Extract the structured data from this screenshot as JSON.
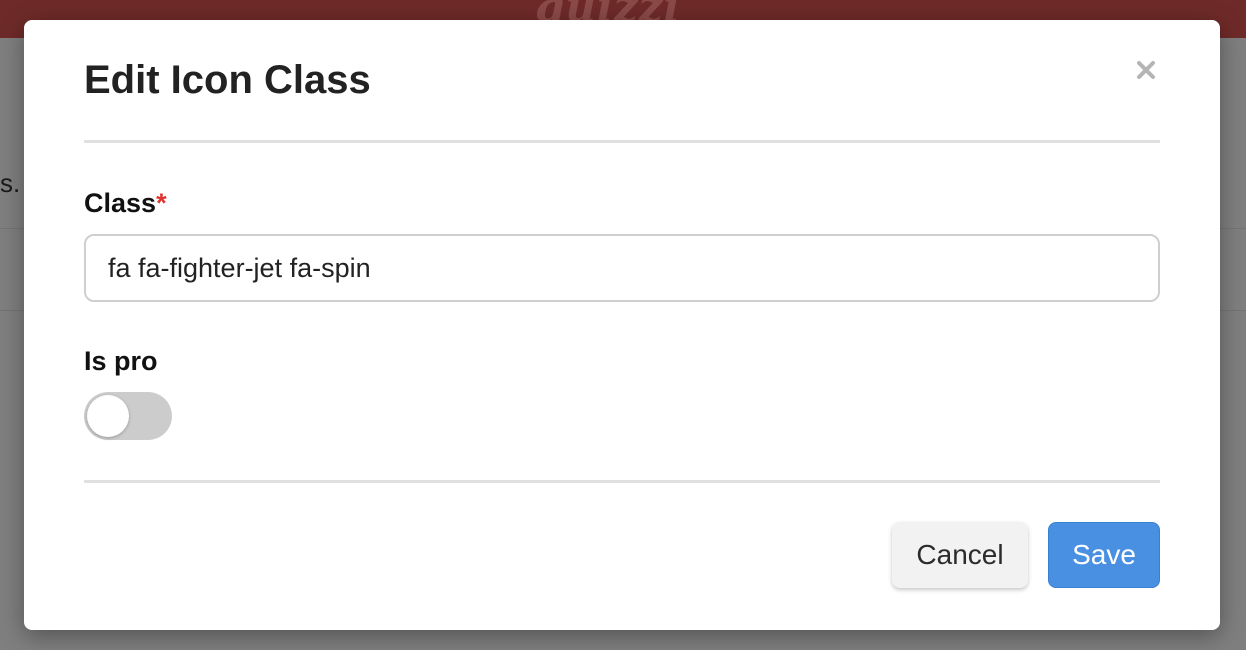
{
  "background": {
    "header_color": "#6e2a28",
    "logo_text": "quizzi",
    "text_fragment": "s."
  },
  "modal": {
    "title": "Edit Icon Class",
    "close_icon": "close-icon"
  },
  "form": {
    "class_field": {
      "label": "Class",
      "required_mark": "*",
      "value": "fa fa-fighter-jet fa-spin",
      "placeholder": ""
    },
    "is_pro_field": {
      "label": "Is pro",
      "checked": false
    }
  },
  "footer": {
    "cancel_label": "Cancel",
    "save_label": "Save"
  },
  "colors": {
    "accent": "#4a90e2",
    "required": "#e0332f",
    "toggle_off": "#cccccc"
  }
}
